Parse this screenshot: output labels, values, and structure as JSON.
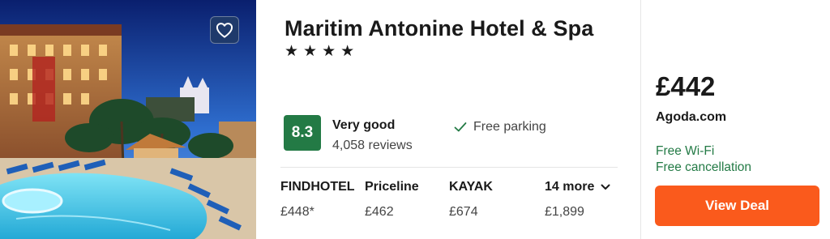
{
  "hotel": {
    "name": "Maritim Antonine Hotel & Spa",
    "star_rating": 4,
    "stars": [
      "★",
      "★",
      "★",
      "★"
    ]
  },
  "rating": {
    "score": "8.3",
    "label": "Very good",
    "reviews": "4,058 reviews"
  },
  "amenities": [
    {
      "label": "Free parking",
      "icon": "check-icon"
    }
  ],
  "offers": [
    {
      "provider": "FINDHOTEL",
      "price": "£448*"
    },
    {
      "provider": "Priceline",
      "price": "£462"
    },
    {
      "provider": "KAYAK",
      "price": "£674"
    }
  ],
  "more_offers": {
    "label": "14 more",
    "price": "£1,899"
  },
  "deal": {
    "price": "£442",
    "provider": "Agoda.com",
    "perks": [
      "Free Wi-Fi",
      "Free cancellation"
    ],
    "button_label": "View Deal"
  },
  "colors": {
    "rating_green": "#237a45",
    "perk_green": "#237a45",
    "deal_orange": "#fa5a1c",
    "favorite_button": "#1f3a6b"
  },
  "icons": {
    "favorite": "heart-icon",
    "expand": "chevron-down-icon",
    "amenity": "check-icon"
  }
}
